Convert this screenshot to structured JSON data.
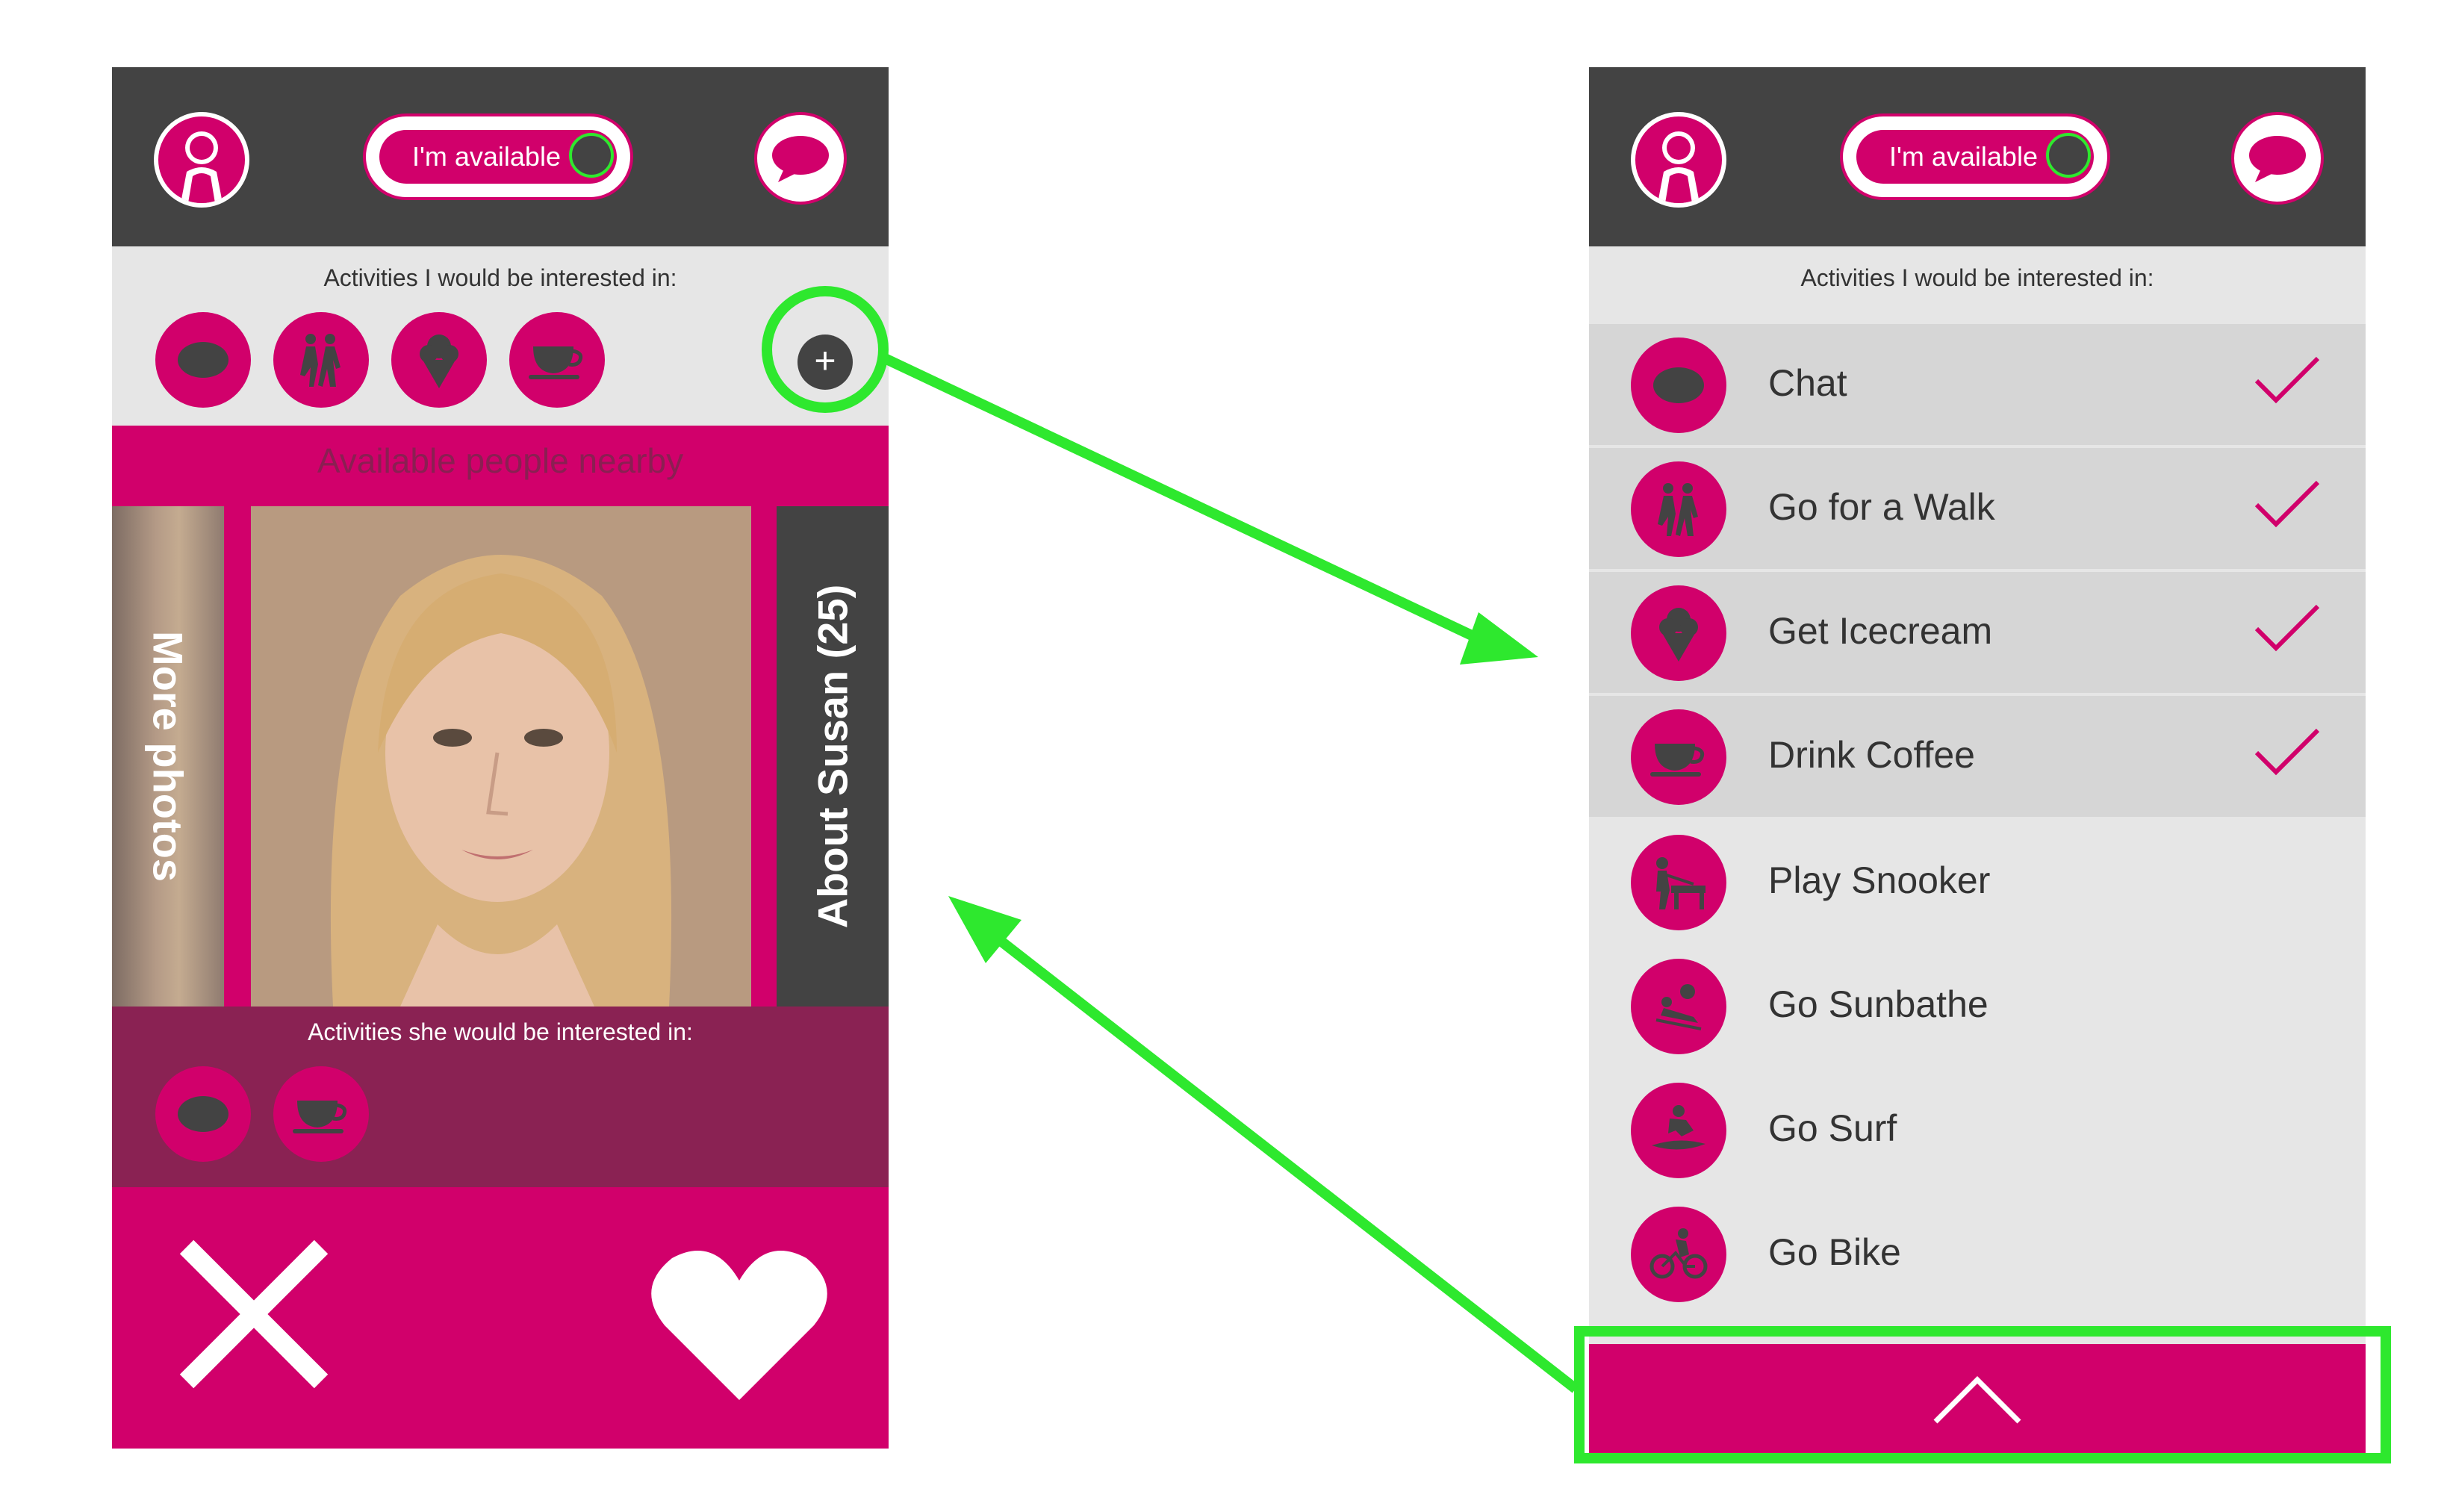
{
  "colors": {
    "accent": "#d1006b",
    "dark": "#434343",
    "highlight": "#2ee82e",
    "panel": "#e6e6e6",
    "her_band": "#8a2253"
  },
  "left_screen": {
    "availability_toggle_label": "I'm available",
    "activities_caption": "Activities I would be interested in:",
    "my_activity_icons": [
      "chat-icon",
      "walk-icon",
      "icecream-icon",
      "coffee-icon"
    ],
    "add_icon": "+",
    "nearby_title": "Available people nearby",
    "more_photos_label": "More photos",
    "about_label": "About Susan (25)",
    "her_activities_caption": "Activities she would be interested in:",
    "her_activity_icons": [
      "chat-icon",
      "coffee-icon"
    ]
  },
  "right_screen": {
    "availability_toggle_label": "I'm available",
    "activities_caption": "Activities I would be interested in:",
    "activities": [
      {
        "label": "Chat",
        "icon": "chat-icon",
        "selected": true
      },
      {
        "label": "Go for a Walk",
        "icon": "walk-icon",
        "selected": true
      },
      {
        "label": "Get Icecream",
        "icon": "icecream-icon",
        "selected": true
      },
      {
        "label": "Drink Coffee",
        "icon": "coffee-icon",
        "selected": true
      },
      {
        "label": "Play Snooker",
        "icon": "snooker-icon",
        "selected": false
      },
      {
        "label": "Go Sunbathe",
        "icon": "sunbathe-icon",
        "selected": false
      },
      {
        "label": "Go Surf",
        "icon": "surf-icon",
        "selected": false
      },
      {
        "label": "Go Bike",
        "icon": "bike-icon",
        "selected": false
      }
    ]
  }
}
